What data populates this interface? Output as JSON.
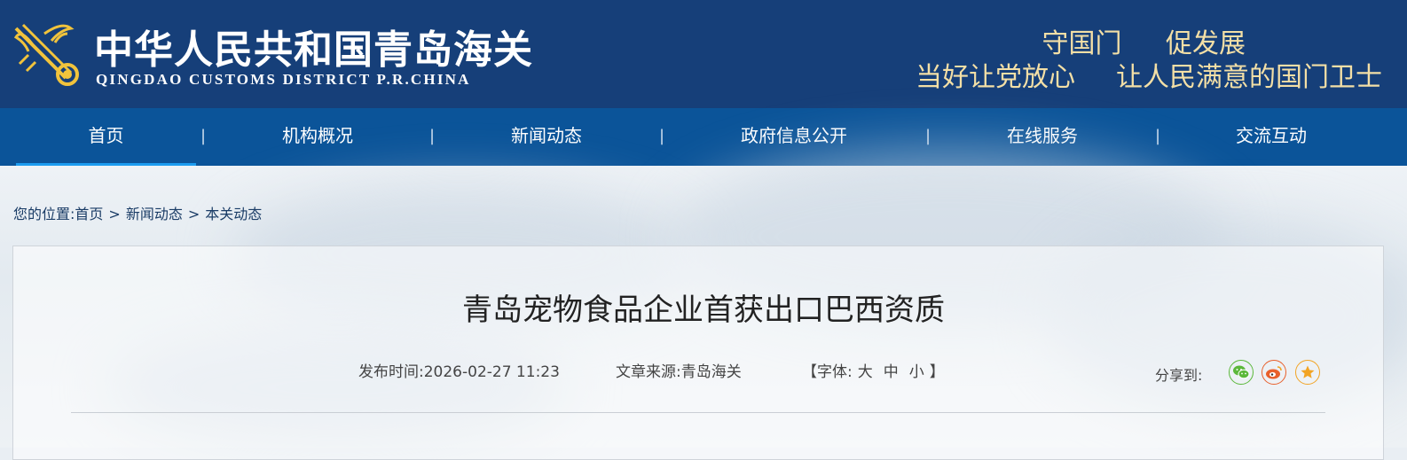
{
  "header": {
    "title_cn": "中华人民共和国青岛海关",
    "title_en": "QINGDAO CUSTOMS DISTRICT P.R.CHINA",
    "slogan_line1": "守国门 促发展",
    "slogan_line2_a": "当好让党放心",
    "slogan_line2_b": "让人民满意的国门卫士"
  },
  "nav": {
    "items": [
      {
        "label": "首页"
      },
      {
        "label": "机构概况"
      },
      {
        "label": "新闻动态"
      },
      {
        "label": "政府信息公开"
      },
      {
        "label": "在线服务"
      },
      {
        "label": "交流互动"
      }
    ],
    "separator": "|"
  },
  "breadcrumb": {
    "prefix": "您的位置:",
    "items": [
      "首页",
      "新闻动态",
      "本关动态"
    ],
    "sep": ">"
  },
  "article": {
    "title": "青岛宠物食品企业首获出口巴西资质",
    "publish_label": "发布时间:",
    "publish_time": "2026-02-27 11:23",
    "source_label": "文章来源:",
    "source": "青岛海关",
    "font_open": "【字体:",
    "font_large": "大",
    "font_medium": "中",
    "font_small": "小",
    "font_close": "】",
    "share_label": "分享到:"
  },
  "colors": {
    "header_bg": "#163f79",
    "nav_bg": "#0b5499",
    "active_underline": "#1c9cf0",
    "slogan": "#f3dfa6",
    "wechat": "#5bb83a",
    "weibo": "#e8602c",
    "favorite": "#f2a424"
  },
  "icons": [
    "customs-emblem-icon",
    "wechat-icon",
    "weibo-icon",
    "favorite-star-icon"
  ]
}
